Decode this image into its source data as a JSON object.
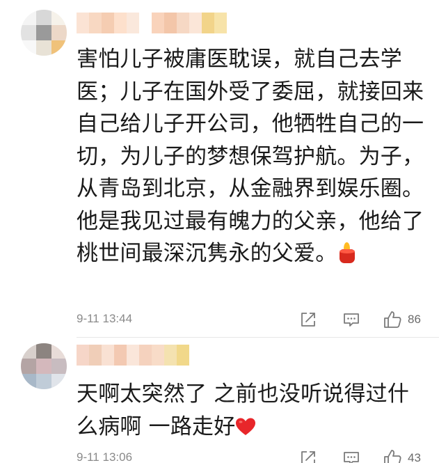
{
  "comments": [
    {
      "text": "害怕儿子被庸医耽误，就自己去学医；儿子在国外受了委屈，就接回来自己给儿子开公司，他牺牲自己的一切，为儿子的梦想保驾护航。为子，从青岛到北京，从金融界到娱乐圈。他是我见过最有魄力的父亲，他给了桃世间最深沉隽永的父爱。",
      "emoji": "candle-emoji",
      "timestamp": "9-11 13:44",
      "likes": "86",
      "avatar_colors": [
        "#f4f4f4",
        "#d8d8d8",
        "#f6f2ea",
        "#e2e2e2",
        "#9a9a9a",
        "#ecd8c8",
        "#f8f8f8",
        "#e8e2d6",
        "#f0c27a"
      ],
      "username_colors": [
        "#fbe3d4",
        "#f8d8c2",
        "#f5cdb2",
        "#fde0cc",
        "#fae8dc",
        "#ffffff",
        "#f9d3bb",
        "#f3c6a9",
        "#f6d8c4",
        "#fbe6d8",
        "#f2d48a",
        "#f7e3a9"
      ]
    },
    {
      "text": "天啊太突然了 之前也没听说得过什么病啊 一路走好",
      "emoji": "heart-emoji",
      "timestamp": "9-11 13:06",
      "likes": "43",
      "avatar_colors": [
        "#d8d0cc",
        "#8c8480",
        "#e8dcd8",
        "#b4a4a4",
        "#d4b8bc",
        "#c8bcc0",
        "#a8b8c8",
        "#c0ccd8",
        "#e0e4ea"
      ],
      "username_colors": [
        "#f6d6c8",
        "#f0ceb8",
        "#f9e1d3",
        "#f3c9b2",
        "#fae6da",
        "#f5d2be",
        "#f8dcc8",
        "#f4e2b0",
        "#f1d88a"
      ]
    }
  ],
  "icons": {
    "share": "share-icon",
    "reply": "comment-icon",
    "like": "thumbs-up-icon"
  }
}
